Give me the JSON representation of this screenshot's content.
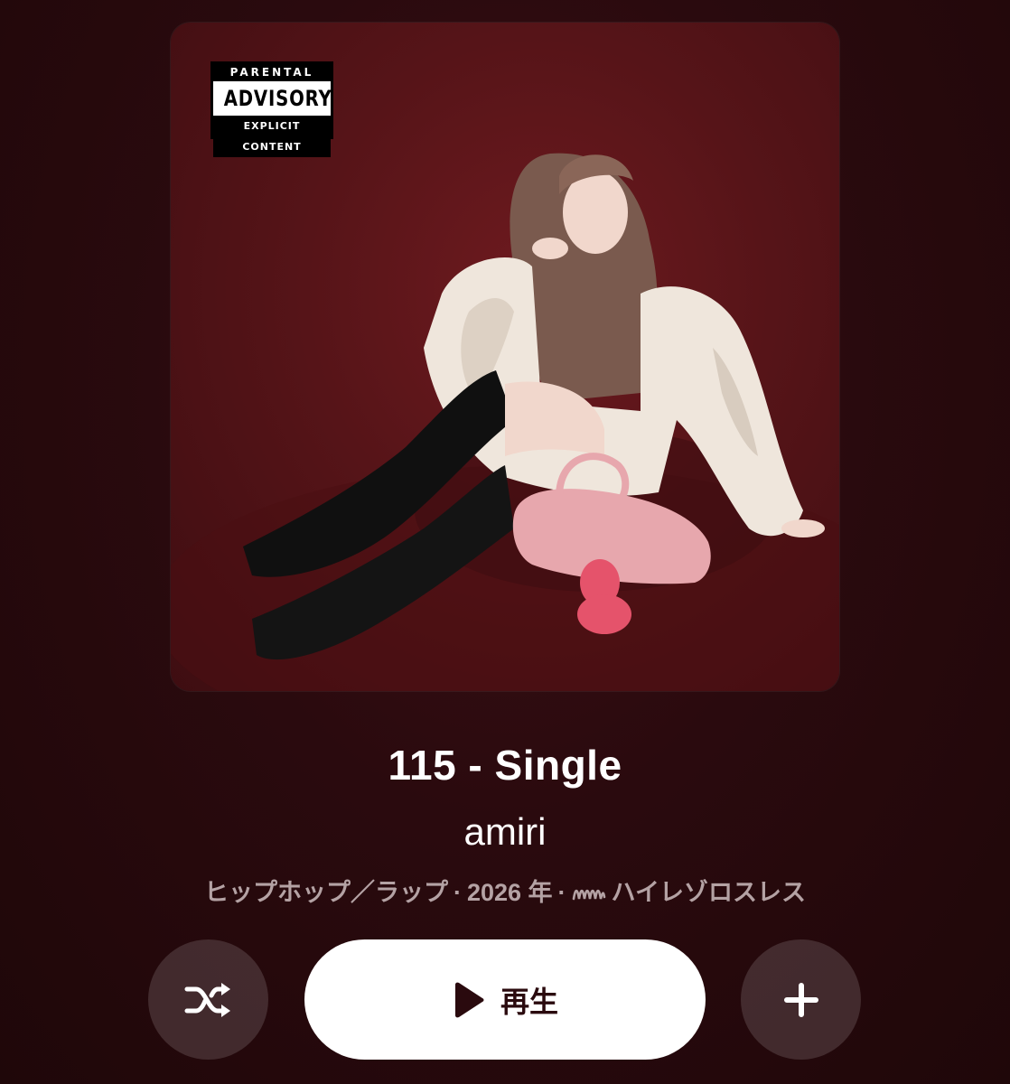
{
  "artwork": {
    "alt": "",
    "advisory": {
      "top": "PARENTAL",
      "middle": "ADVISORY",
      "bottom": "EXPLICIT CONTENT"
    }
  },
  "album": {
    "title": "115 - Single",
    "artist": "amiri",
    "genre": "ヒップホップ／ラップ",
    "separator": "·",
    "year": "2026 年",
    "quality_icon": "hi-res-lossless-icon",
    "quality": "ハイレゾロスレス"
  },
  "controls": {
    "shuffle_icon": "shuffle-icon",
    "play_icon": "play-icon",
    "play_label": "再生",
    "add_icon": "plus-icon"
  },
  "colors": {
    "background": "#2a0a0e",
    "meta_text": "#b4a2a4",
    "button_bg": "#ffffff"
  }
}
